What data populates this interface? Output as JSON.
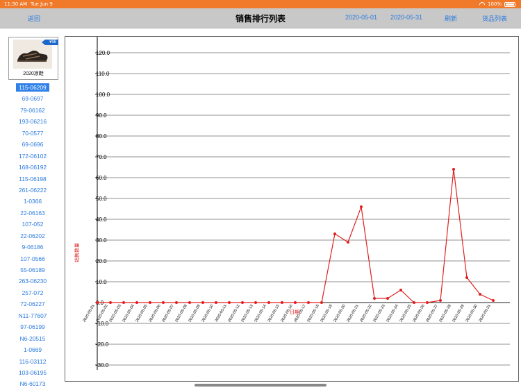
{
  "status_bar": {
    "time": "11:30 AM",
    "date": "Tue Jun 9",
    "battery": "100%"
  },
  "nav": {
    "back": "返回",
    "title": "销售排行列表",
    "date_start": "2020-05-01",
    "date_end": "2020-05-31",
    "refresh": "刷新",
    "goods_list": "货品列表"
  },
  "product": {
    "name": "2020凉鞋",
    "price": "¥98"
  },
  "items": [
    "115-06209",
    "69-0697",
    "79-06162",
    "193-06216",
    "70-0577",
    "69-0696",
    "172-06102",
    "168-06192",
    "115-06198",
    "261-06222",
    "1-0366",
    "22-06163",
    "107-052",
    "22-06202",
    "9-06186",
    "107-0566",
    "55-06189",
    "263-06230",
    "257-072",
    "72-06227",
    "N11-77607",
    "97-06199",
    "N6-20515",
    "1-0669",
    "116-03112",
    "103-06195",
    "N6-60173"
  ],
  "selected_index": 0,
  "colors": {
    "accent": "#2a7adf",
    "series": "#e02020",
    "status": "#f07a2a"
  },
  "chart_data": {
    "type": "line",
    "ylabel": "销售数量",
    "xlabel": "日期",
    "ylim": [
      -35,
      125
    ],
    "yticks": [
      "120.0",
      "110.0",
      "100.0",
      "90.0",
      "80.0",
      "70.0",
      "60.0",
      "50.0",
      "40.0",
      "30.0",
      "20.0",
      "10.0",
      "0.0",
      "-10.0",
      "-20.0",
      "-30.0"
    ],
    "x": [
      "2020-05-01",
      "2020-05-02",
      "2020-05-03",
      "2020-05-04",
      "2020-05-05",
      "2020-05-06",
      "2020-05-07",
      "2020-05-08",
      "2020-05-09",
      "2020-05-10",
      "2020-05-11",
      "2020-05-12",
      "2020-05-13",
      "2020-05-14",
      "2020-05-15",
      "2020-05-16",
      "2020-05-17",
      "2020-05-18",
      "2020-05-19",
      "2020-05-20",
      "2020-05-21",
      "2020-05-22",
      "2020-05-23",
      "2020-05-24",
      "2020-05-25",
      "2020-05-26",
      "2020-05-27",
      "2020-05-28",
      "2020-05-29",
      "2020-05-30",
      "2020-05-31"
    ],
    "values": [
      0,
      0,
      0,
      0,
      0,
      0,
      0,
      0,
      0,
      0,
      0,
      0,
      0,
      0,
      0,
      0,
      0,
      0,
      33,
      29,
      46,
      2,
      2,
      6,
      0,
      0,
      1,
      64,
      12,
      4,
      1
    ],
    "grid": true
  }
}
